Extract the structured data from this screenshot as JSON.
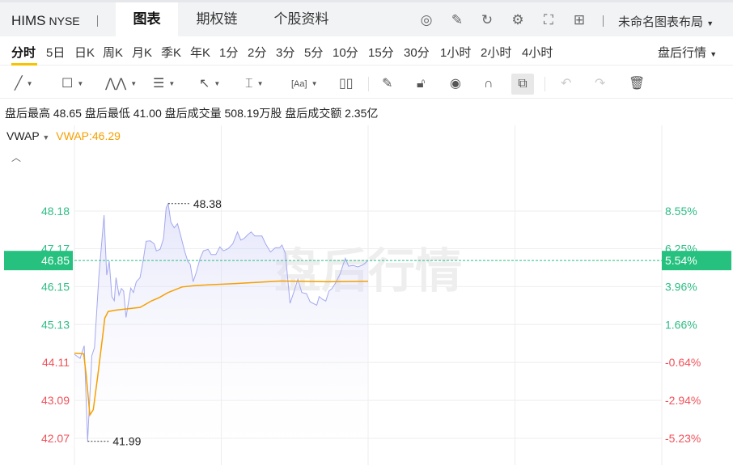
{
  "header": {
    "symbol": "HIMS",
    "exchange": "NYSE",
    "tabs": [
      {
        "label": "图表",
        "active": true
      },
      {
        "label": "期权链"
      },
      {
        "label": "个股资料"
      }
    ],
    "icons": [
      "speed-icon",
      "edit-icon",
      "refresh-icon",
      "settings-icon",
      "fullscreen-icon",
      "grid-icon"
    ],
    "layout_label": "未命名图表布局"
  },
  "timeframes": [
    "分时",
    "5日",
    "日K",
    "周K",
    "月K",
    "季K",
    "年K",
    "1分",
    "2分",
    "3分",
    "5分",
    "10分",
    "15分",
    "30分",
    "1小时",
    "2小时",
    "4小时"
  ],
  "session_select": "盘后行情",
  "toolbar": [
    "trend-line-icon",
    "rectangle-icon",
    "pattern-icon",
    "fib-icon",
    "arrow-icon",
    "measure-icon",
    "text-icon",
    "candle-icon",
    "pencil-icon",
    "lock-icon",
    "eye-icon",
    "magnet-icon",
    "link-icon",
    "undo-icon",
    "redo-icon",
    "trash-icon"
  ],
  "stats": "盘后最高 48.65 盘后最低 41.00 盘后成交量 508.19万股 盘后成交额 2.35亿",
  "indicator": {
    "name": "VWAP",
    "value": "VWAP:46.29"
  },
  "watermark": "盘后行情",
  "colors": {
    "up": "#2ebd85",
    "down": "#f0525a",
    "price_line": "#a4a8ef",
    "vwap": "#f5a000",
    "badge": "#26c17f"
  },
  "chart_data": {
    "type": "line",
    "ylim": [
      41.6,
      48.9
    ],
    "xlim": [
      0,
      240
    ],
    "prev_close": 44.39,
    "left_ticks": [
      "48.18",
      "47.17",
      "46.15",
      "45.13",
      "44.11",
      "43.09",
      "42.07"
    ],
    "right_ticks": [
      "8.55%",
      "6.25%",
      "3.96%",
      "1.66%",
      "-0.64%",
      "-2.94%",
      "-5.23%"
    ],
    "current": {
      "price": "46.85",
      "pct": "5.54%"
    },
    "high_label": {
      "t": 38.3,
      "value": "48.38"
    },
    "low_label": {
      "t": 5.4,
      "value": "41.99"
    },
    "series": [
      {
        "name": "price",
        "points": [
          [
            0,
            44.33
          ],
          [
            2.3,
            44.22
          ],
          [
            4,
            44.56
          ],
          [
            5.4,
            41.99
          ],
          [
            7.1,
            44.29
          ],
          [
            8.2,
            44.51
          ],
          [
            10,
            46.46
          ],
          [
            12.1,
            48.07
          ],
          [
            13.2,
            46.46
          ],
          [
            14.2,
            46.83
          ],
          [
            15.3,
            45.88
          ],
          [
            16.3,
            45.77
          ],
          [
            17,
            46.39
          ],
          [
            18.2,
            45.92
          ],
          [
            19.2,
            46.1
          ],
          [
            20.1,
            46.03
          ],
          [
            21.1,
            45.32
          ],
          [
            23,
            46.11
          ],
          [
            24.1,
            45.99
          ],
          [
            25.3,
            46.28
          ],
          [
            26.8,
            46.39
          ],
          [
            28.2,
            46.9
          ],
          [
            29.3,
            47.37
          ],
          [
            31,
            47.38
          ],
          [
            32.6,
            47.3
          ],
          [
            33.5,
            47.11
          ],
          [
            35,
            47.15
          ],
          [
            36.4,
            47.44
          ],
          [
            37.5,
            48.27
          ],
          [
            38.3,
            48.38
          ],
          [
            39.4,
            47.88
          ],
          [
            40.8,
            47.73
          ],
          [
            42.1,
            47.84
          ],
          [
            43.3,
            47.55
          ],
          [
            45,
            47.11
          ],
          [
            46.3,
            46.83
          ],
          [
            47.3,
            46.75
          ],
          [
            48.5,
            46.28
          ],
          [
            49.8,
            46.53
          ],
          [
            51.3,
            46.9
          ],
          [
            52.7,
            47.11
          ],
          [
            54.6,
            47.15
          ],
          [
            55.9,
            47.01
          ],
          [
            57.8,
            47.01
          ],
          [
            59.4,
            47.22
          ],
          [
            60.9,
            47.11
          ],
          [
            62.8,
            47.17
          ],
          [
            64.7,
            47.3
          ],
          [
            66.6,
            47.62
          ],
          [
            68,
            47.4
          ],
          [
            69.3,
            47.44
          ],
          [
            70.9,
            47.55
          ],
          [
            72.2,
            47.62
          ],
          [
            73.7,
            47.51
          ],
          [
            76.6,
            47.51
          ],
          [
            78.1,
            47.3
          ],
          [
            80.1,
            47.08
          ],
          [
            82,
            47.19
          ],
          [
            83.9,
            47.2
          ],
          [
            84.8,
            47.27
          ],
          [
            86.2,
            47.04
          ],
          [
            87.1,
            46.39
          ],
          [
            88.1,
            45.7
          ],
          [
            89.6,
            45.99
          ],
          [
            91.3,
            46.35
          ],
          [
            92.9,
            45.99
          ],
          [
            94.8,
            45.96
          ],
          [
            96.3,
            45.74
          ],
          [
            99,
            45.65
          ],
          [
            100,
            45.88
          ],
          [
            101.3,
            45.81
          ],
          [
            102.7,
            45.76
          ],
          [
            104,
            46.03
          ],
          [
            105.3,
            46.1
          ],
          [
            106.7,
            46.25
          ],
          [
            108.6,
            46.5
          ],
          [
            109.7,
            46.72
          ],
          [
            110.7,
            46.91
          ],
          [
            112,
            46.7
          ],
          [
            113.9,
            46.72
          ],
          [
            115.8,
            46.68
          ],
          [
            117.8,
            46.73
          ],
          [
            120,
            46.85
          ]
        ]
      },
      {
        "name": "VWAP",
        "points": [
          [
            0,
            44.36
          ],
          [
            3.8,
            44.34
          ],
          [
            4.8,
            43.78
          ],
          [
            6.3,
            42.7
          ],
          [
            7.7,
            42.84
          ],
          [
            9.6,
            43.78
          ],
          [
            11.5,
            44.8
          ],
          [
            12.4,
            45.3
          ],
          [
            13.8,
            45.48
          ],
          [
            17.2,
            45.52
          ],
          [
            26.8,
            45.59
          ],
          [
            31.6,
            45.77
          ],
          [
            34.5,
            45.85
          ],
          [
            38.3,
            45.99
          ],
          [
            44,
            46.14
          ],
          [
            49.8,
            46.18
          ],
          [
            65.1,
            46.23
          ],
          [
            84.3,
            46.3
          ],
          [
            103.4,
            46.28
          ],
          [
            120,
            46.29
          ]
        ]
      }
    ]
  }
}
